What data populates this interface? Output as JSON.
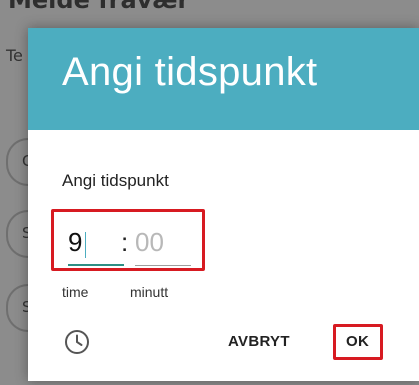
{
  "background": {
    "title_partial": "Melde fravær",
    "subtitle_partial": "Te",
    "options": [
      "C",
      "S",
      "S"
    ]
  },
  "dialog": {
    "title": "Angi tidspunkt",
    "input_label": "Angi tidspunkt",
    "hour": {
      "value": "9",
      "label": "time"
    },
    "separator": ":",
    "minute": {
      "value": "",
      "placeholder": "00",
      "label": "minutt"
    },
    "cancel_label": "AVBRYT",
    "ok_label": "OK",
    "mode_icon": "clock-icon"
  },
  "colors": {
    "header": "#4cadc0",
    "highlight": "#d71a21",
    "active_underline": "#2d8f85"
  }
}
